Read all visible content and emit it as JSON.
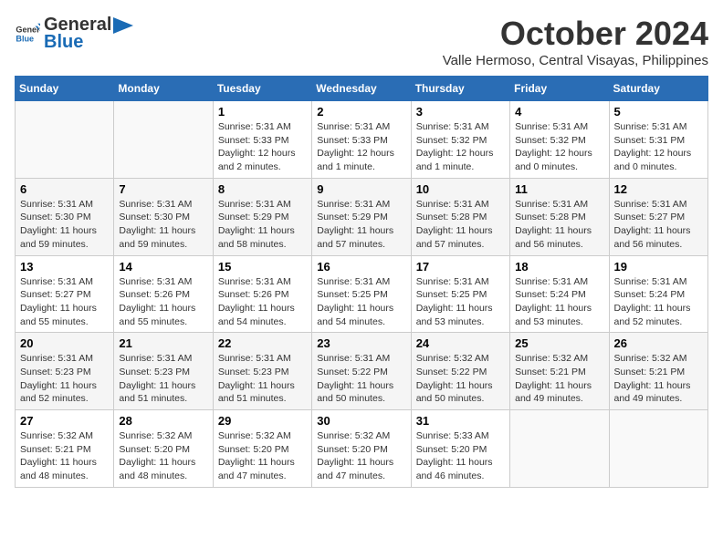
{
  "header": {
    "logo_general": "General",
    "logo_blue": "Blue",
    "month_year": "October 2024",
    "location": "Valle Hermoso, Central Visayas, Philippines"
  },
  "days_of_week": [
    "Sunday",
    "Monday",
    "Tuesday",
    "Wednesday",
    "Thursday",
    "Friday",
    "Saturday"
  ],
  "weeks": [
    [
      {
        "day": "",
        "info": ""
      },
      {
        "day": "",
        "info": ""
      },
      {
        "day": "1",
        "info": "Sunrise: 5:31 AM\nSunset: 5:33 PM\nDaylight: 12 hours and 2 minutes."
      },
      {
        "day": "2",
        "info": "Sunrise: 5:31 AM\nSunset: 5:33 PM\nDaylight: 12 hours and 1 minute."
      },
      {
        "day": "3",
        "info": "Sunrise: 5:31 AM\nSunset: 5:32 PM\nDaylight: 12 hours and 1 minute."
      },
      {
        "day": "4",
        "info": "Sunrise: 5:31 AM\nSunset: 5:32 PM\nDaylight: 12 hours and 0 minutes."
      },
      {
        "day": "5",
        "info": "Sunrise: 5:31 AM\nSunset: 5:31 PM\nDaylight: 12 hours and 0 minutes."
      }
    ],
    [
      {
        "day": "6",
        "info": "Sunrise: 5:31 AM\nSunset: 5:30 PM\nDaylight: 11 hours and 59 minutes."
      },
      {
        "day": "7",
        "info": "Sunrise: 5:31 AM\nSunset: 5:30 PM\nDaylight: 11 hours and 59 minutes."
      },
      {
        "day": "8",
        "info": "Sunrise: 5:31 AM\nSunset: 5:29 PM\nDaylight: 11 hours and 58 minutes."
      },
      {
        "day": "9",
        "info": "Sunrise: 5:31 AM\nSunset: 5:29 PM\nDaylight: 11 hours and 57 minutes."
      },
      {
        "day": "10",
        "info": "Sunrise: 5:31 AM\nSunset: 5:28 PM\nDaylight: 11 hours and 57 minutes."
      },
      {
        "day": "11",
        "info": "Sunrise: 5:31 AM\nSunset: 5:28 PM\nDaylight: 11 hours and 56 minutes."
      },
      {
        "day": "12",
        "info": "Sunrise: 5:31 AM\nSunset: 5:27 PM\nDaylight: 11 hours and 56 minutes."
      }
    ],
    [
      {
        "day": "13",
        "info": "Sunrise: 5:31 AM\nSunset: 5:27 PM\nDaylight: 11 hours and 55 minutes."
      },
      {
        "day": "14",
        "info": "Sunrise: 5:31 AM\nSunset: 5:26 PM\nDaylight: 11 hours and 55 minutes."
      },
      {
        "day": "15",
        "info": "Sunrise: 5:31 AM\nSunset: 5:26 PM\nDaylight: 11 hours and 54 minutes."
      },
      {
        "day": "16",
        "info": "Sunrise: 5:31 AM\nSunset: 5:25 PM\nDaylight: 11 hours and 54 minutes."
      },
      {
        "day": "17",
        "info": "Sunrise: 5:31 AM\nSunset: 5:25 PM\nDaylight: 11 hours and 53 minutes."
      },
      {
        "day": "18",
        "info": "Sunrise: 5:31 AM\nSunset: 5:24 PM\nDaylight: 11 hours and 53 minutes."
      },
      {
        "day": "19",
        "info": "Sunrise: 5:31 AM\nSunset: 5:24 PM\nDaylight: 11 hours and 52 minutes."
      }
    ],
    [
      {
        "day": "20",
        "info": "Sunrise: 5:31 AM\nSunset: 5:23 PM\nDaylight: 11 hours and 52 minutes."
      },
      {
        "day": "21",
        "info": "Sunrise: 5:31 AM\nSunset: 5:23 PM\nDaylight: 11 hours and 51 minutes."
      },
      {
        "day": "22",
        "info": "Sunrise: 5:31 AM\nSunset: 5:23 PM\nDaylight: 11 hours and 51 minutes."
      },
      {
        "day": "23",
        "info": "Sunrise: 5:31 AM\nSunset: 5:22 PM\nDaylight: 11 hours and 50 minutes."
      },
      {
        "day": "24",
        "info": "Sunrise: 5:32 AM\nSunset: 5:22 PM\nDaylight: 11 hours and 50 minutes."
      },
      {
        "day": "25",
        "info": "Sunrise: 5:32 AM\nSunset: 5:21 PM\nDaylight: 11 hours and 49 minutes."
      },
      {
        "day": "26",
        "info": "Sunrise: 5:32 AM\nSunset: 5:21 PM\nDaylight: 11 hours and 49 minutes."
      }
    ],
    [
      {
        "day": "27",
        "info": "Sunrise: 5:32 AM\nSunset: 5:21 PM\nDaylight: 11 hours and 48 minutes."
      },
      {
        "day": "28",
        "info": "Sunrise: 5:32 AM\nSunset: 5:20 PM\nDaylight: 11 hours and 48 minutes."
      },
      {
        "day": "29",
        "info": "Sunrise: 5:32 AM\nSunset: 5:20 PM\nDaylight: 11 hours and 47 minutes."
      },
      {
        "day": "30",
        "info": "Sunrise: 5:32 AM\nSunset: 5:20 PM\nDaylight: 11 hours and 47 minutes."
      },
      {
        "day": "31",
        "info": "Sunrise: 5:33 AM\nSunset: 5:20 PM\nDaylight: 11 hours and 46 minutes."
      },
      {
        "day": "",
        "info": ""
      },
      {
        "day": "",
        "info": ""
      }
    ]
  ]
}
